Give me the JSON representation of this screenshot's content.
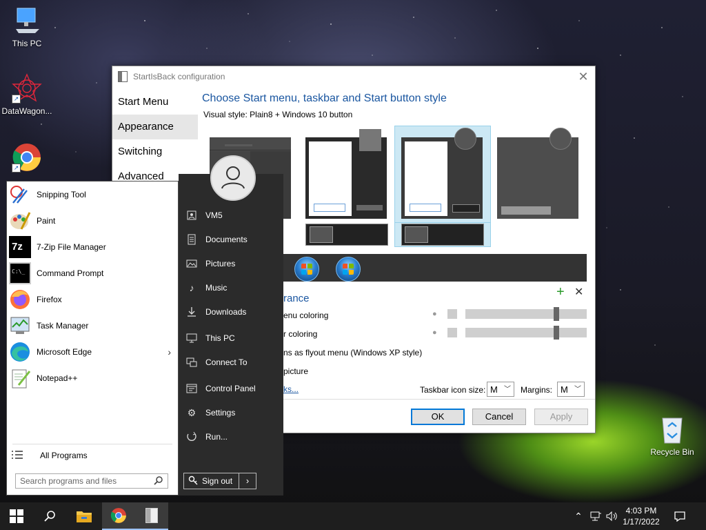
{
  "desktop": {
    "icons": [
      {
        "label": "This PC",
        "icon": "computer-icon"
      },
      {
        "label": "DataWagon...",
        "icon": "datawagon-icon"
      },
      {
        "label": "Chrome",
        "icon": "chrome-icon"
      },
      {
        "label": "Recycle Bin",
        "icon": "recycle-bin-icon"
      }
    ]
  },
  "config_window": {
    "title": "StartIsBack configuration",
    "nav": [
      "Start Menu",
      "Appearance",
      "Switching",
      "Advanced"
    ],
    "heading": "Choose Start menu, taskbar and Start button style",
    "visual_style_label": "Visual style:",
    "visual_style_value": "Plain8 + Windows 10 button",
    "section_title_fragment": "rance",
    "options": {
      "menu_coloring": "enu coloring",
      "taskbar_coloring": "r coloring",
      "flyout": "ns as flyout menu (Windows XP style)",
      "picture": "picture",
      "link": "ks..."
    },
    "taskbar_icon_size_label": "Taskbar icon size:",
    "taskbar_icon_size_value": "M",
    "margins_label": "Margins:",
    "margins_value": "M",
    "buttons": {
      "ok": "OK",
      "cancel": "Cancel",
      "apply": "Apply"
    },
    "colors": {
      "accent": "#1a56a0",
      "selection": "#cce8f4"
    }
  },
  "start_menu": {
    "programs": [
      {
        "label": "Snipping Tool",
        "icon": "snipping-tool-icon"
      },
      {
        "label": "Paint",
        "icon": "paint-icon"
      },
      {
        "label": "7-Zip File Manager",
        "icon": "7zip-icon",
        "badge": "7z"
      },
      {
        "label": "Command Prompt",
        "icon": "command-prompt-icon",
        "badge": "C:\\_"
      },
      {
        "label": "Firefox",
        "icon": "firefox-icon"
      },
      {
        "label": "Task Manager",
        "icon": "task-manager-icon"
      },
      {
        "label": "Microsoft Edge",
        "icon": "edge-icon"
      },
      {
        "label": "Notepad++",
        "icon": "notepadpp-icon"
      }
    ],
    "all_programs": "All Programs",
    "search_placeholder": "Search programs and files",
    "right_items": [
      {
        "label": "VM5",
        "icon": "user-folder-icon"
      },
      {
        "label": "Documents",
        "icon": "documents-icon"
      },
      {
        "label": "Pictures",
        "icon": "pictures-icon"
      },
      {
        "label": "Music",
        "icon": "music-icon"
      },
      {
        "label": "Downloads",
        "icon": "downloads-icon"
      },
      {
        "label": "This PC",
        "icon": "computer-icon"
      },
      {
        "label": "Connect To",
        "icon": "connect-icon"
      },
      {
        "label": "Control Panel",
        "icon": "control-panel-icon"
      },
      {
        "label": "Settings",
        "icon": "gear-icon"
      },
      {
        "label": "Run...",
        "icon": "run-icon"
      }
    ],
    "sign_out": "Sign out"
  },
  "taskbar": {
    "clock_time": "4:03 PM",
    "clock_date": "1/17/2022"
  }
}
